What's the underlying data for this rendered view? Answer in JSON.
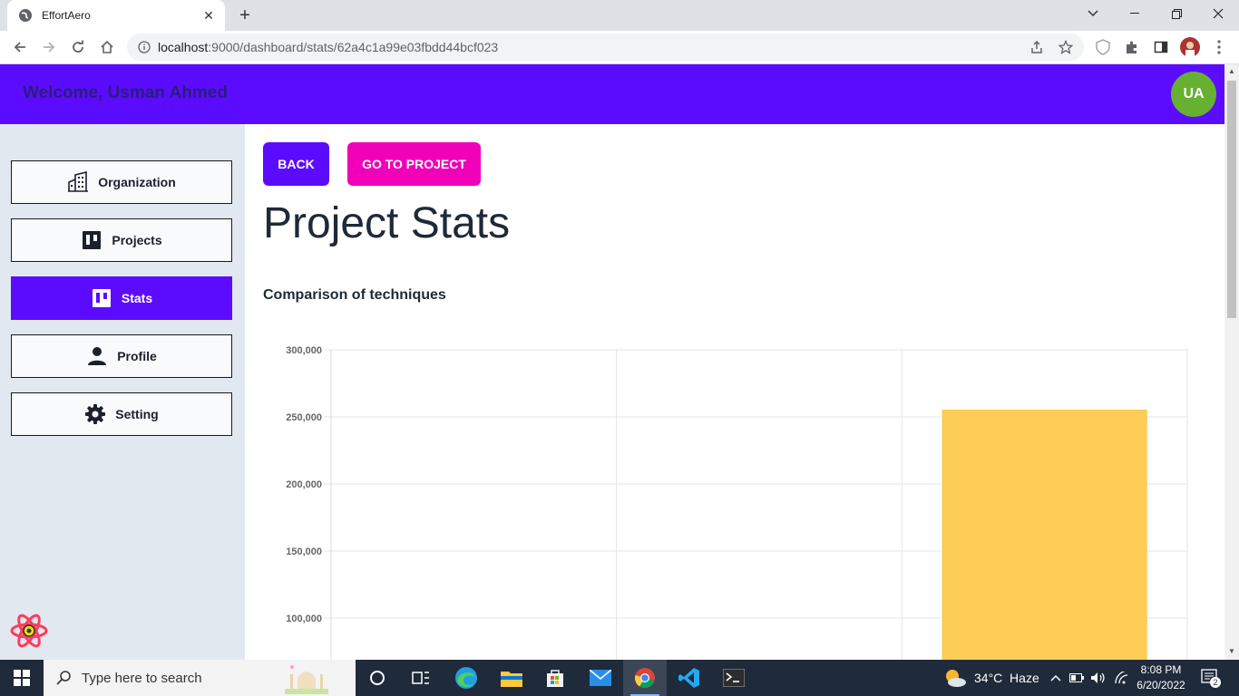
{
  "browser": {
    "tab_title": "EffortAero",
    "url_host": "localhost",
    "url_rest": ":9000/dashboard/stats/62a4c1a99e03fbdd44bcf023"
  },
  "header": {
    "welcome": "Welcome, Usman Ahmed",
    "avatar_initials": "UA",
    "bg_color": "#5b0cff",
    "avatar_color": "#66b032"
  },
  "sidebar": {
    "items": [
      {
        "label": "Organization",
        "icon": "building-icon",
        "active": false
      },
      {
        "label": "Projects",
        "icon": "board-icon",
        "active": false
      },
      {
        "label": "Stats",
        "icon": "board-icon",
        "active": true
      },
      {
        "label": "Profile",
        "icon": "person-icon",
        "active": false
      },
      {
        "label": "Setting",
        "icon": "gear-icon",
        "active": false
      }
    ]
  },
  "main": {
    "back_label": "BACK",
    "go_project_label": "GO TO PROJECT",
    "title": "Project Stats",
    "chart_heading": "Comparison of techniques"
  },
  "chart_data": {
    "type": "bar",
    "title": "Comparison of techniques",
    "categories": [
      "",
      "",
      ""
    ],
    "series": [
      {
        "values": [
          null,
          null,
          255000
        ],
        "color": "#fecd56"
      }
    ],
    "y_ticks": [
      "300,000",
      "250,000",
      "200,000",
      "150,000",
      "100,000"
    ],
    "ylim_visible": [
      75000,
      300000
    ],
    "grid": true
  },
  "taskbar": {
    "search_placeholder": "Type here to search",
    "weather": "34°C  Haze",
    "time": "8:08 PM",
    "date": "6/20/2022",
    "notifications": "2"
  }
}
